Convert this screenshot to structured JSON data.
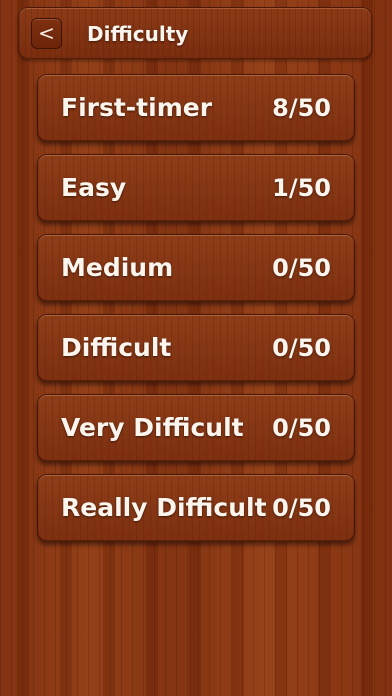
{
  "header": {
    "back_label": "<",
    "title": "Difficulty"
  },
  "levels": [
    {
      "name": "First-timer",
      "progress": "8/50"
    },
    {
      "name": "Easy",
      "progress": "1/50"
    },
    {
      "name": "Medium",
      "progress": "0/50"
    },
    {
      "name": "Difficult",
      "progress": "0/50"
    },
    {
      "name": "Very Difficult",
      "progress": "0/50"
    },
    {
      "name": "Really Difficult",
      "progress": "0/50"
    }
  ]
}
